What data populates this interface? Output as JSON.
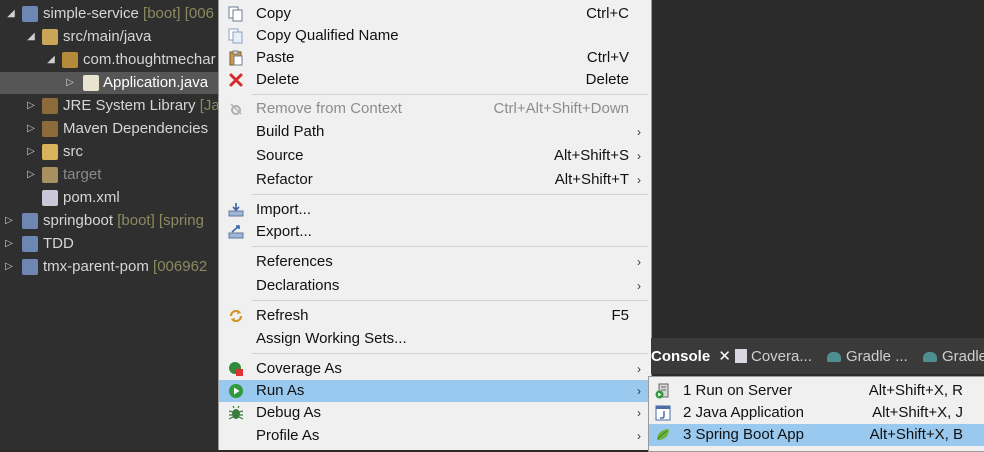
{
  "tree": {
    "items": [
      {
        "name": "simple-service",
        "deco": "[boot] [006"
      },
      {
        "name": "src/main/java"
      },
      {
        "name": "com.thoughtmechar"
      },
      {
        "name": "Application.java"
      },
      {
        "name": "JRE System Library",
        "deco": "[Jav"
      },
      {
        "name": "Maven Dependencies"
      },
      {
        "name": "src"
      },
      {
        "name": "target"
      },
      {
        "name": "pom.xml"
      },
      {
        "name": "springboot",
        "deco": "[boot] [spring"
      },
      {
        "name": "TDD"
      },
      {
        "name": "tmx-parent-pom",
        "deco": "[006962"
      }
    ]
  },
  "menu": {
    "items": [
      {
        "label": "Copy",
        "key": "Ctrl+C",
        "icon": "copy-icon"
      },
      {
        "label": "Copy Qualified Name",
        "icon": "copy-qualified-icon"
      },
      {
        "label": "Paste",
        "key": "Ctrl+V",
        "icon": "paste-icon"
      },
      {
        "label": "Delete",
        "key": "Delete",
        "icon": "delete-icon"
      },
      {
        "label": "Remove from Context",
        "key": "Ctrl+Alt+Shift+Down",
        "icon": "remove-context-icon",
        "disabled": true
      },
      {
        "label": "Build Path",
        "submenu": true
      },
      {
        "label": "Source",
        "key": "Alt+Shift+S",
        "submenu": true
      },
      {
        "label": "Refactor",
        "key": "Alt+Shift+T",
        "submenu": true
      },
      {
        "label": "Import...",
        "icon": "import-icon"
      },
      {
        "label": "Export...",
        "icon": "export-icon"
      },
      {
        "label": "References",
        "submenu": true
      },
      {
        "label": "Declarations",
        "submenu": true
      },
      {
        "label": "Refresh",
        "key": "F5",
        "icon": "refresh-icon"
      },
      {
        "label": "Assign Working Sets..."
      },
      {
        "label": "Coverage As",
        "icon": "coverage-icon",
        "submenu": true
      },
      {
        "label": "Run As",
        "icon": "run-icon",
        "submenu": true,
        "highlighted": true
      },
      {
        "label": "Debug As",
        "icon": "debug-icon",
        "submenu": true
      },
      {
        "label": "Profile As",
        "submenu": true
      }
    ],
    "arrow": "›"
  },
  "console": {
    "tabs": [
      {
        "label": "Console",
        "active": true,
        "close": "✕"
      },
      {
        "label": "Covera..."
      },
      {
        "label": "Gradle ..."
      },
      {
        "label": "Gradle"
      }
    ]
  },
  "run_as_submenu": {
    "items": [
      {
        "label": "1 Run on Server",
        "key": "Alt+Shift+X, R",
        "icon": "server-run-icon"
      },
      {
        "label": "2 Java Application",
        "key": "Alt+Shift+X, J",
        "icon": "java-app-icon"
      },
      {
        "label": "3 Spring Boot App",
        "key": "Alt+Shift+X, B",
        "icon": "spring-boot-icon",
        "highlighted": true
      }
    ]
  },
  "colors": {
    "highlight": "#99c9ef",
    "menu_bg": "#f0f0f0",
    "tree_bg": "#2f2f2f",
    "decoration": "#8b8b60"
  }
}
